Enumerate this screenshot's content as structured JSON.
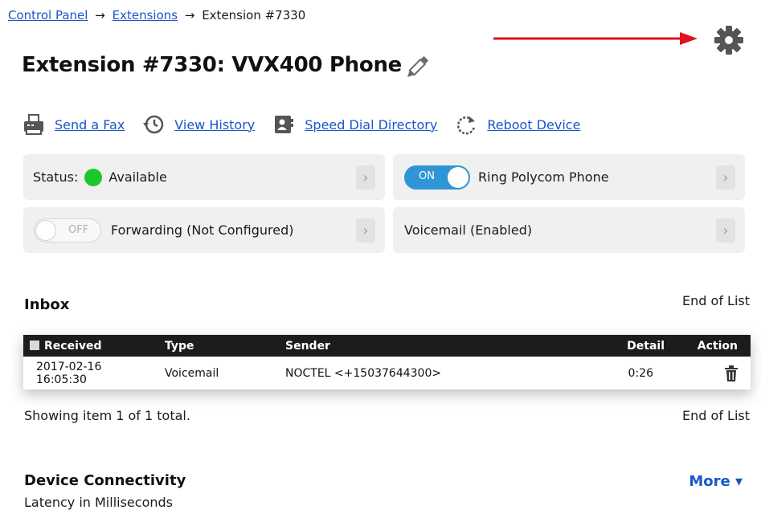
{
  "breadcrumb": {
    "items": [
      "Control Panel",
      "Extensions",
      "Extension #7330"
    ],
    "separator": "→"
  },
  "title": "Extension #7330: VVX400 Phone",
  "icons": {
    "settings": "gear-icon",
    "annotation_arrow": "red-arrow",
    "edit": "pencil-icon"
  },
  "colors": {
    "link": "#1a56c8",
    "status_available": "#1ec62c",
    "toggle_on": "#2f95d6",
    "arrow": "#e0121d"
  },
  "actions": [
    {
      "label": "Send a Fax",
      "icon": "fax-icon"
    },
    {
      "label": "View History",
      "icon": "history-icon"
    },
    {
      "label": "Speed Dial Directory",
      "icon": "directory-icon"
    },
    {
      "label": "Reboot Device",
      "icon": "reboot-icon"
    }
  ],
  "cards": {
    "status": {
      "label": "Status:",
      "value": "Available"
    },
    "ring": {
      "toggle": "ON",
      "label": "Ring Polycom Phone"
    },
    "forwarding": {
      "toggle": "OFF",
      "label": "Forwarding (Not Configured)"
    },
    "voicemail": {
      "label": "Voicemail (Enabled)"
    },
    "chevron": "›"
  },
  "inbox": {
    "title": "Inbox",
    "end_of_list": "End of List",
    "columns": [
      "Received",
      "Type",
      "Sender",
      "Detail",
      "Action"
    ],
    "rows": [
      {
        "received_date": "2017-02-16",
        "received_time": "16:05:30",
        "type": "Voicemail",
        "sender": "NOCTEL <+15037644300>",
        "detail": "0:26",
        "action": "trash-icon"
      }
    ],
    "showing": "Showing item 1 of 1 total."
  },
  "connectivity": {
    "title": "Device Connectivity",
    "subtitle": "Latency in Milliseconds",
    "more": "More ▾"
  }
}
